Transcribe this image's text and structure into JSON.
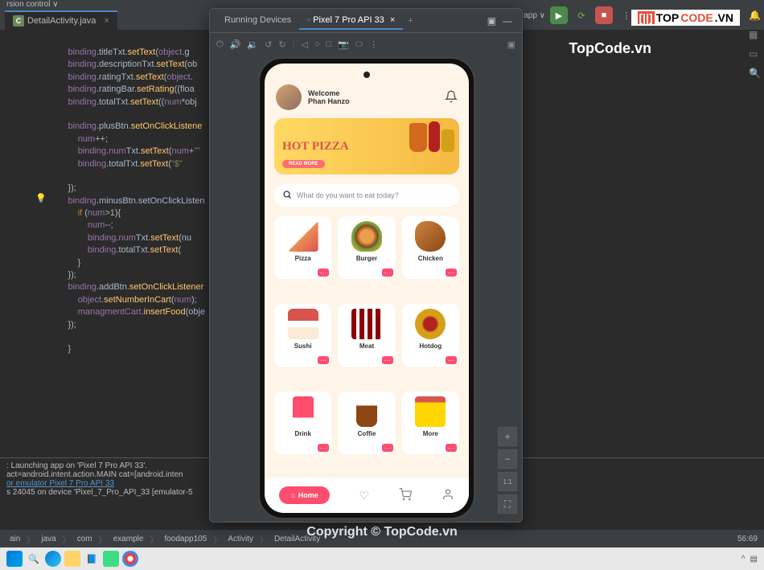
{
  "toolbar": {
    "version_control": "rsion control ∨",
    "app_dropdown": "app ∨"
  },
  "filetab": {
    "name": "DetailActivity.java"
  },
  "code_lines": [
    "binding.titleTxt.setText(object.g",
    "binding.descriptionTxt.setText(ob",
    "binding.ratingTxt.setText(object.",
    "binding.ratingBar.setRating((floa",
    "binding.totalTxt.setText((num*obj",
    "",
    "binding.plusBtn.setOnClickListene",
    "    num++;",
    "    binding.numTxt.setText(num+\"\"",
    "    binding.totalTxt.setText(\"$\" ",
    "",
    "});",
    "binding.minusBtn.setOnClickListen",
    "    if (num>1){",
    "        num--;",
    "        binding.numTxt.setText(nu",
    "        binding.totalTxt.setText(",
    "    }",
    "});",
    "binding.addBtn.setOnClickListener",
    "    object.setNumberInCart(num);",
    "    managmentCart.insertFood(obje",
    "});",
    "",
    "}"
  ],
  "devices": {
    "tab1": "Running Devices",
    "tab2": "Pixel 7 Pro API 33"
  },
  "app": {
    "welcome": "Welcome",
    "username": "Phan Hanzo",
    "banner_title": "HOT PIZZA",
    "banner_btn": "READ MORE",
    "search_placeholder": "What do you want to eat today?",
    "categories": [
      {
        "label": "Pizza"
      },
      {
        "label": "Burger"
      },
      {
        "label": "Chicken"
      },
      {
        "label": "Sushi"
      },
      {
        "label": "Meat"
      },
      {
        "label": "Hotdog"
      },
      {
        "label": "Drink"
      },
      {
        "label": "Coffie"
      },
      {
        "label": "More"
      }
    ],
    "nav_home": "Home"
  },
  "console": {
    "l1": ": Launching app on 'Pixel 7 Pro API 33'.",
    "l2": "act=android.intent.action.MAIN cat=[android.inten",
    "l3": "or emulator Pixel 7 Pro API 33",
    "l4": "s 24045 on device 'Pixel_7_Pro_API_33 [emulator-5"
  },
  "breadcrumb": {
    "items": [
      "ain",
      "java",
      "com",
      "example",
      "foodapp105",
      "Activity",
      "DetailActivity"
    ],
    "pos": "56:69"
  },
  "watermark": {
    "top": "TopCode.vn",
    "center": "Copyright © TopCode.vn",
    "logo1": "TOP",
    "logo2": "CODE",
    "logo3": ".VN"
  },
  "zoom": {
    "scale": "1:1"
  }
}
